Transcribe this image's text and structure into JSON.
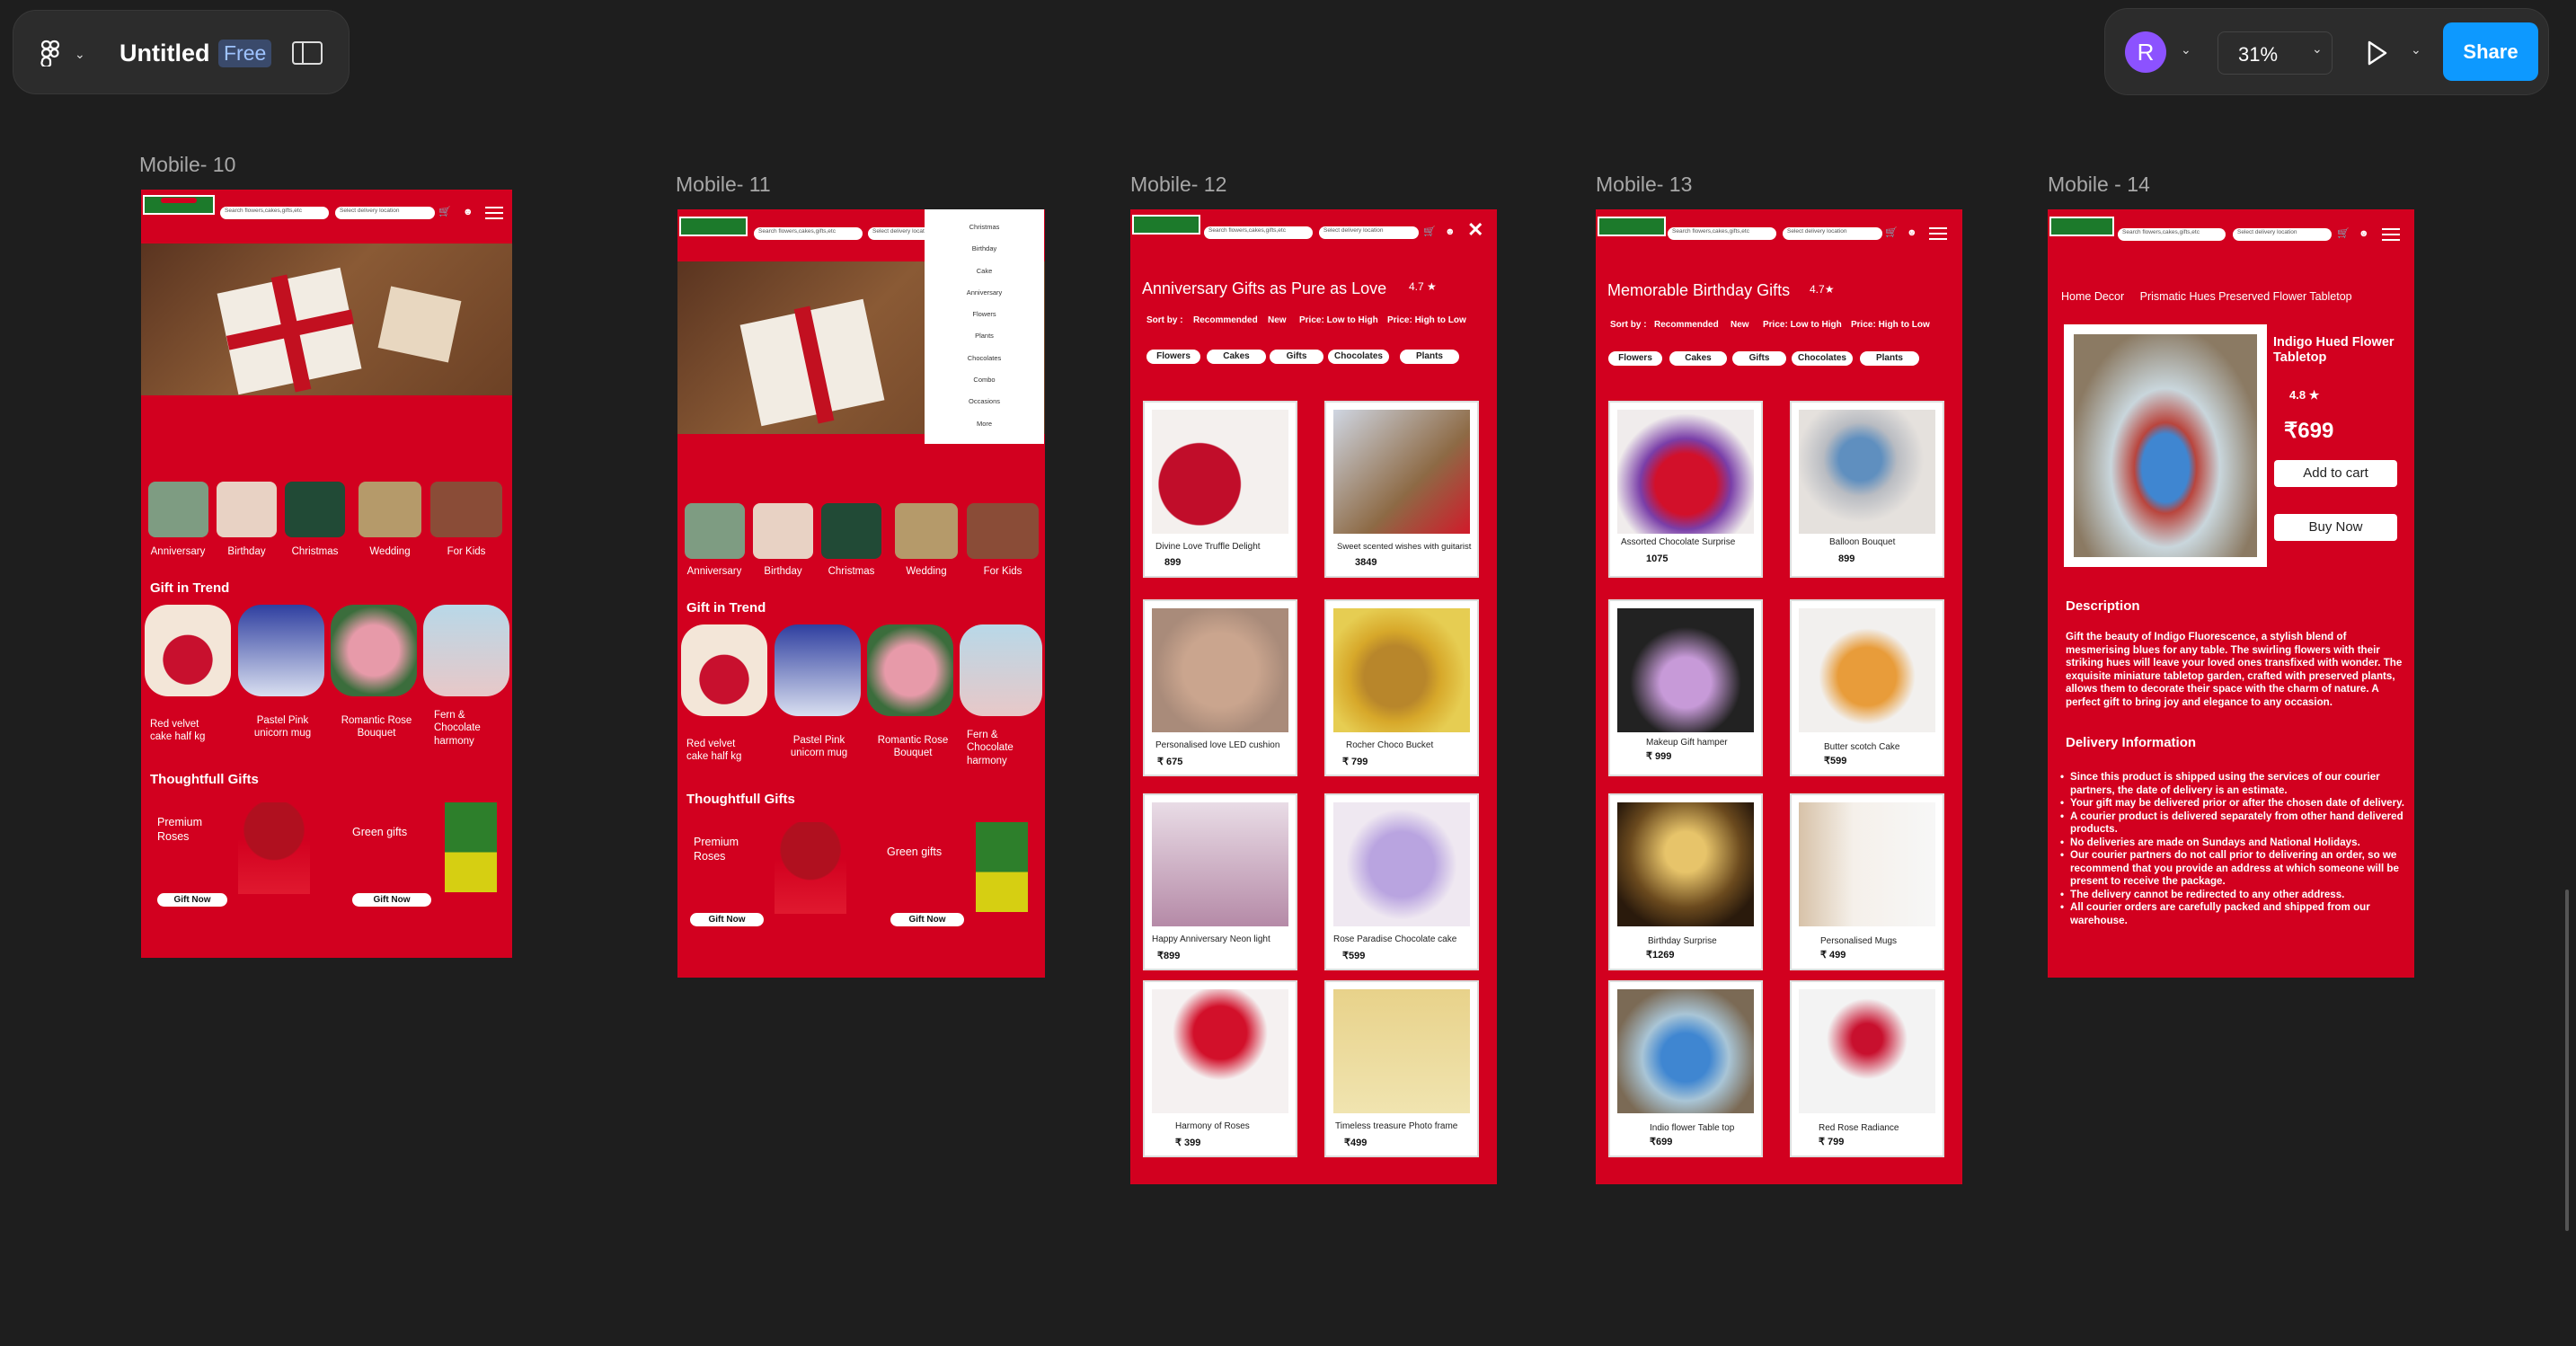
{
  "toolbar": {
    "file_name": "Untitled",
    "plan_badge": "Free",
    "avatar_initial": "R",
    "zoom": "31%",
    "share_label": "Share",
    "icons": [
      "figma-logo-icon",
      "chevron-down-icon",
      "sidebar-toggle-icon",
      "play-icon",
      "share-button"
    ]
  },
  "colors": {
    "canvas": "#1e1e1e",
    "toolbar": "#2c2c2c",
    "brand_red": "#d2001f",
    "share_blue": "#0d99ff",
    "avatar_purple": "#8c52ff"
  },
  "frames": {
    "m10": {
      "label": "Mobile- 10"
    },
    "m11": {
      "label": "Mobile- 11"
    },
    "m12": {
      "label": "Mobile- 12"
    },
    "m13": {
      "label": "Mobile- 13"
    },
    "m14": {
      "label": "Mobile - 14"
    }
  },
  "header": {
    "search_placeholder": "Search flowers,cakes,gifts,etc",
    "location_placeholder": "Select delivery location"
  },
  "home": {
    "categories": [
      "Anniversary",
      "Birthday",
      "Christmas",
      "Wedding",
      "For Kids"
    ],
    "trend_heading": "Gift in Trend",
    "trend_items": [
      "Red velvet cake half kg",
      "Pastel Pink unicorn mug",
      "Romantic Rose Bouquet",
      "Fern & Chocolate harmony"
    ],
    "thoughtful_heading": "Thoughtfull Gifts",
    "thoughtful_items": [
      {
        "title": "Premium Roses",
        "cta": "Gift Now"
      },
      {
        "title": "Green gifts",
        "cta": "Gift Now"
      }
    ]
  },
  "menu": {
    "items": [
      "Christmas",
      "Birthday",
      "Cake",
      "Anniversary",
      "Flowers",
      "Plants",
      "Chocolates",
      "Combo",
      "Occasions",
      "More"
    ]
  },
  "listing_anniversary": {
    "title": "Anniversary Gifts as Pure as Love",
    "rating": "4.7",
    "sort_label": "Sort by :",
    "sort_options": [
      "Recommended",
      "New",
      "Price: Low to High",
      "Price: High to Low"
    ],
    "chips": [
      "Flowers",
      "Cakes",
      "Gifts",
      "Chocolates",
      "Plants"
    ],
    "products": [
      {
        "name": "Divine Love Truffle Delight",
        "price": "899"
      },
      {
        "name": "Sweet scented wishes with guitarist",
        "price": "3849"
      },
      {
        "name": "Personalised love LED cushion",
        "price": "₹ 675"
      },
      {
        "name": "Rocher Choco Bucket",
        "price": "₹ 799"
      },
      {
        "name": "Happy Anniversary Neon light",
        "price": "₹899"
      },
      {
        "name": "Rose Paradise Chocolate cake",
        "price": "₹599"
      },
      {
        "name": "Harmony of Roses",
        "price": "₹  399"
      },
      {
        "name": "Timeless treasure Photo frame",
        "price": "₹499"
      }
    ]
  },
  "listing_birthday": {
    "title": "Memorable Birthday Gifts",
    "rating": "4.7",
    "sort_label": "Sort by :",
    "sort_options": [
      "Recommended",
      "New",
      "Price: Low to High",
      "Price: High to Low"
    ],
    "chips": [
      "Flowers",
      "Cakes",
      "Gifts",
      "Chocolates",
      "Plants"
    ],
    "products": [
      {
        "name": "Assorted Chocolate Surprise",
        "price": "1075"
      },
      {
        "name": "Balloon Bouquet",
        "price": "899"
      },
      {
        "name": "Makeup Gift hamper",
        "price": "₹ 999"
      },
      {
        "name": "Butter scotch Cake",
        "price": "₹599"
      },
      {
        "name": "Birthday Surprise",
        "price": "₹1269"
      },
      {
        "name": "Personalised Mugs",
        "price": "₹ 499"
      },
      {
        "name": "Indio flower Table top",
        "price": "₹699"
      },
      {
        "name": "Red Rose Radiance",
        "price": "₹ 799"
      }
    ]
  },
  "product": {
    "breadcrumb_root": "Home Decor",
    "breadcrumb_item": "Prismatic Hues Preserved Flower Tabletop",
    "name": "Indigo Hued Flower Tabletop",
    "rating": "4.8",
    "price": "₹699",
    "add_to_cart": "Add to cart",
    "buy_now": "Buy Now",
    "desc_heading": "Description",
    "description": "Gift the beauty of Indigo Fluorescence, a stylish blend of mesmerising blues for any table. The swirling flowers with their striking hues will leave your loved ones transfixed with wonder. The exquisite miniature tabletop garden, crafted with preserved plants, allows them to decorate their space with the charm of nature. A perfect gift to bring joy and elegance to any occasion.",
    "delivery_heading": "Delivery Information",
    "delivery_points": [
      "Since this product is shipped using the services of our courier partners, the date of delivery is an estimate.",
      "Your gift may be delivered prior or after the chosen date of delivery.",
      "A courier product is delivered separately from other hand delivered products.",
      "No deliveries are made on Sundays and National Holidays.",
      "Our courier partners do not call prior to delivering an order, so we recommend that you provide an address at which someone will be present to receive the package.",
      "The delivery cannot be redirected to any other address.",
      "All courier orders are carefully packed and shipped from our warehouse."
    ]
  }
}
